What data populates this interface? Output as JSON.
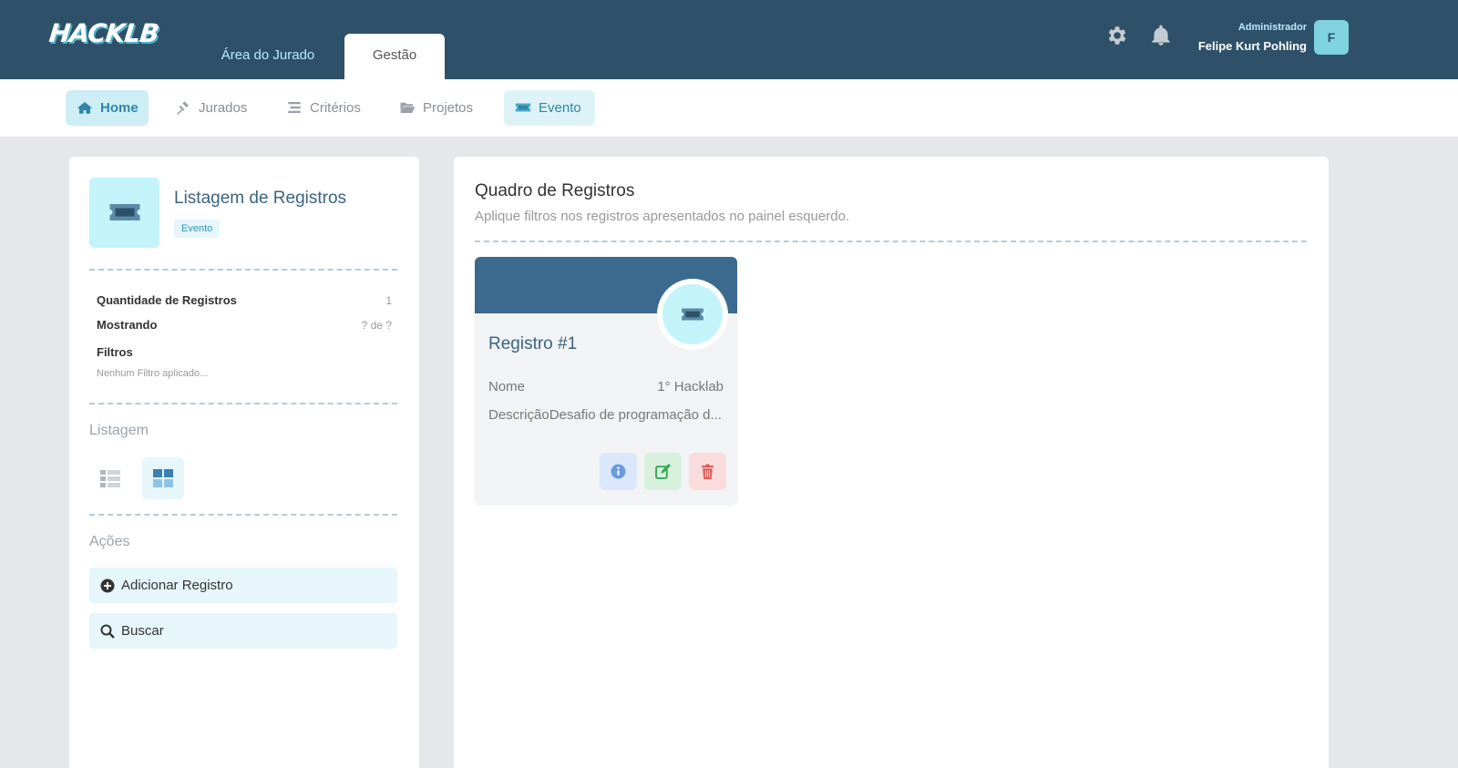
{
  "header": {
    "logo": "HACKLB",
    "tabs": [
      {
        "label": "Área do Jurado",
        "active": false
      },
      {
        "label": "Gestão",
        "active": true
      }
    ],
    "icons": [
      "gear-icon",
      "bell-icon"
    ],
    "user": {
      "role": "Administrador",
      "name": "Felipe Kurt Pohling",
      "initial": "F"
    }
  },
  "subnav": {
    "items": [
      {
        "label": "Home",
        "icon": "home-icon",
        "active": true
      },
      {
        "label": "Jurados",
        "icon": "gavel-icon",
        "active": false
      },
      {
        "label": "Critérios",
        "icon": "list-icon",
        "active": false
      },
      {
        "label": "Projetos",
        "icon": "folder-open-icon",
        "active": false
      },
      {
        "label": "Evento",
        "icon": "ticket-icon",
        "active": true
      }
    ]
  },
  "left_panel": {
    "title": "Listagem de Registros",
    "badge": "Evento",
    "stats": {
      "count_label": "Quantidade de Registros",
      "count_value": "1",
      "showing_label": "Mostrando",
      "showing_value": "? de ?",
      "filters_label": "Filtros",
      "filters_value": "Nenhum Filtro aplicado..."
    },
    "listing_label": "Listagem",
    "actions_label": "Ações",
    "actions": [
      {
        "label": "Adicionar Registro",
        "icon": "plus-circle-icon"
      },
      {
        "label": "Buscar",
        "icon": "search-icon"
      }
    ]
  },
  "right_panel": {
    "title": "Quadro de Registros",
    "subtitle": "Aplique filtros nos registros apresentados no painel esquerdo.",
    "cards": [
      {
        "title": "Registro #1",
        "name_label": "Nome",
        "name_value": "1° Hacklab",
        "desc_label": "Descrição",
        "desc_value": "Desafio de programação d..."
      }
    ]
  },
  "colors": {
    "header_bg": "#2e5069",
    "accent": "#7ed3df",
    "card_header": "#3b6a8e",
    "page_bg": "#e5e7eb"
  }
}
